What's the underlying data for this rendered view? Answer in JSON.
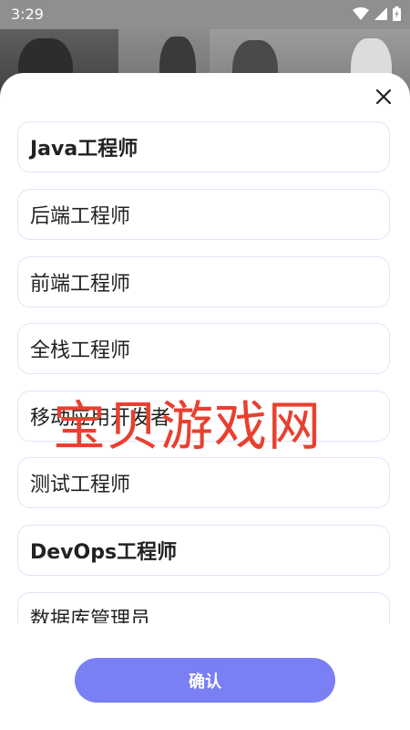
{
  "status_bar": {
    "time": "3:29"
  },
  "sheet": {
    "options": [
      {
        "label": "Java工程师",
        "bold": true
      },
      {
        "label": "后端工程师",
        "bold": false
      },
      {
        "label": "前端工程师",
        "bold": false
      },
      {
        "label": "全栈工程师",
        "bold": false
      },
      {
        "label": "移动应用开发者",
        "bold": false
      },
      {
        "label": "测试工程师",
        "bold": false
      },
      {
        "label": "DevOps工程师",
        "bold": true
      },
      {
        "label": "数据库管理员",
        "bold": false
      }
    ],
    "confirm_label": "确认"
  },
  "watermark": {
    "text": "宝贝游戏网"
  },
  "colors": {
    "accent": "#7a7ff4",
    "border": "#e2e3f6",
    "watermark": "#e8402f"
  },
  "icons": [
    "wifi-icon",
    "signal-icon",
    "battery-icon",
    "close-icon"
  ]
}
